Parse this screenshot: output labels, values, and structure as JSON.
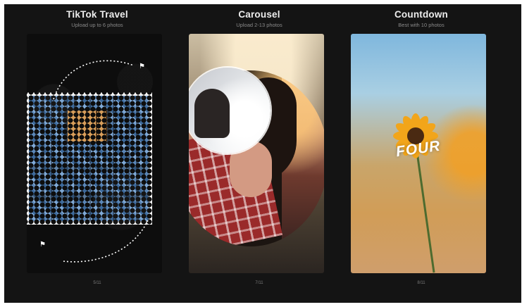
{
  "cards": [
    {
      "title": "TikTok Travel",
      "subtitle": "Upload up to 6 photos",
      "counter": "5/11"
    },
    {
      "title": "Carousel",
      "subtitle": "Upload 2-13 photos",
      "counter": "7/11"
    },
    {
      "title": "Countdown",
      "subtitle": "Best with 10 photos",
      "counter": "8/11",
      "overlay_text": "FOUR"
    }
  ],
  "icons": {
    "flag_top": "flag-icon",
    "flag_bottom": "flag-icon"
  }
}
